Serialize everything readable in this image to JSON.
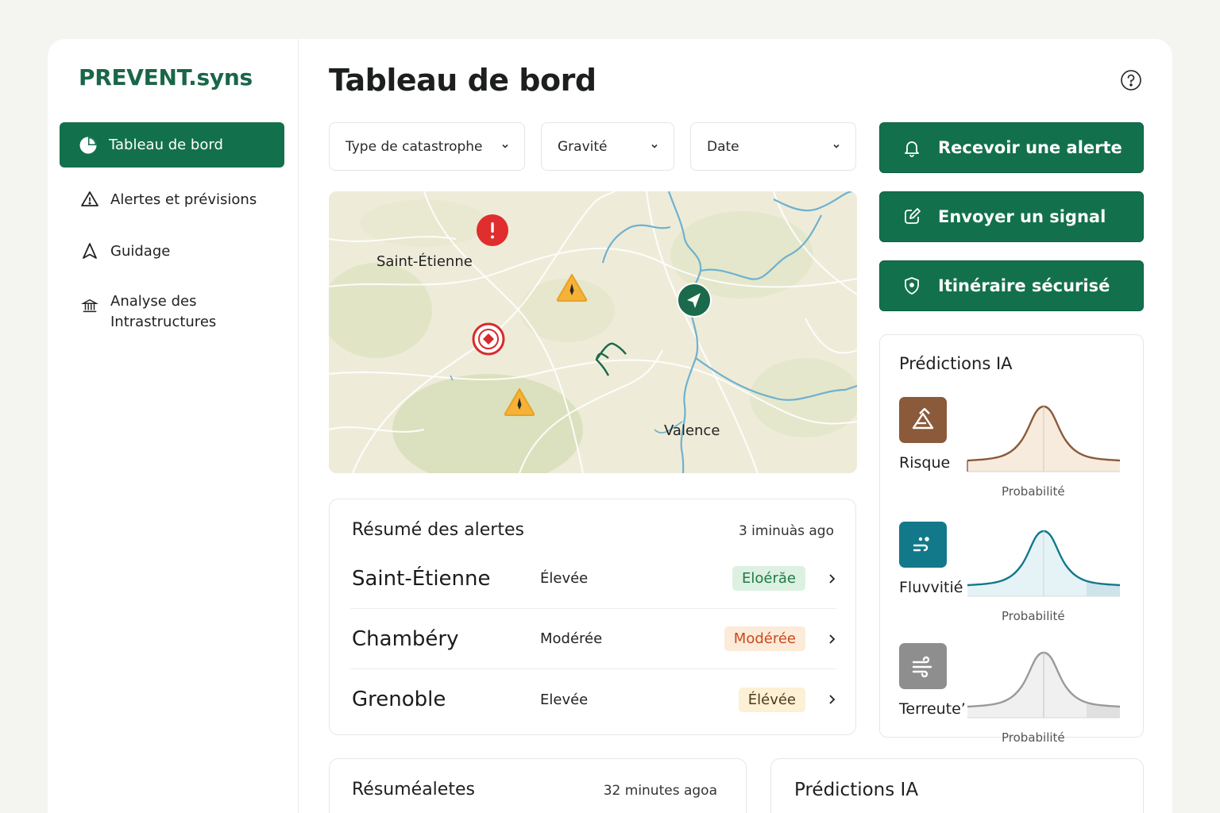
{
  "brand": "PREVENT.syns",
  "nav": {
    "dashboard": "Tableau de bord",
    "alerts": "Alertes et prévisions",
    "guide": "Guidage",
    "infra": "Analyse des Intrastructures"
  },
  "page_title": "Tableau de bord",
  "filters": {
    "type": "Type de catastrophe",
    "severity": "Gravité",
    "date": "Date"
  },
  "map": {
    "labels": [
      "Saint-Étienne",
      "Valence"
    ]
  },
  "actions": {
    "alert": "Recevoir une alerte",
    "signal": "Envoyer un signal",
    "route": "Itinéraire sécurisé"
  },
  "predictions": {
    "title": "Prédictions IA",
    "axis_label": "Probabilité",
    "items": [
      {
        "name": "Risque",
        "color": "#8a5a3a"
      },
      {
        "name": "Fluvvitié",
        "color": "#12798a"
      },
      {
        "name": "Terreute’",
        "color": "#8e8e8e"
      }
    ]
  },
  "alert_summary": {
    "title": "Résumé des alertes",
    "time": "3 iminuàs ago",
    "rows": [
      {
        "city": "Saint-Étienne",
        "severity": "Élevée",
        "badge": "Eloérăe",
        "badge_bg": "#dcf1e2",
        "badge_fg": "#1f7a45"
      },
      {
        "city": "Chambéry",
        "severity": "Modérée",
        "badge": "Modérée",
        "badge_bg": "#fcebd9",
        "badge_fg": "#c94a1e"
      },
      {
        "city": "Grenoble",
        "severity": "Elevée",
        "badge": "Élévée",
        "badge_bg": "#fcf0d5",
        "badge_fg": "#4a3a1a"
      }
    ]
  },
  "bottom": {
    "left_title": "Résuméaletes",
    "left_time": "32 minutes agoa",
    "right_title": "Prédictions IA"
  }
}
